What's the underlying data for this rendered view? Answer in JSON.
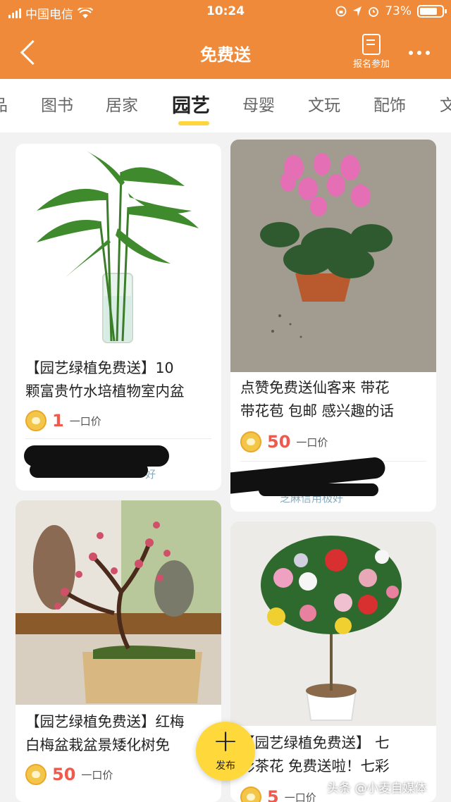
{
  "status_bar": {
    "carrier": "中国电信",
    "time": "10:24",
    "battery": "73%"
  },
  "nav": {
    "title": "免费送",
    "signup_label": "报名参加"
  },
  "tabs": [
    "品",
    "图书",
    "居家",
    "园艺",
    "母婴",
    "文玩",
    "配饰",
    "文"
  ],
  "active_tab": "园艺",
  "cards": [
    {
      "title_line1": "【园艺绿植免费送】10",
      "title_line2": "颗富贵竹水培植物室内盆",
      "price": "1",
      "price_label": "一口价",
      "user_text": "好"
    },
    {
      "title_line1": "点赞免费送仙客来 带花",
      "title_line2": "带花苞 包邮 感兴趣的话",
      "price": "50",
      "price_label": "一口价",
      "user_text": "芝麻信用极好"
    },
    {
      "title_line1": "【园艺绿植免费送】红梅",
      "title_line2": "白梅盆栽盆景矮化树免",
      "price": "50",
      "price_label": "一口价"
    },
    {
      "title_line1": "【园艺绿植免费送】 七",
      "title_line2": "彩茶花 免费送啦！七彩",
      "price": "5",
      "price_label": "一口价"
    }
  ],
  "fab_label": "发布",
  "watermark": "头条 @小麦自媒体",
  "colors": {
    "header": "#ee8a3a",
    "accent": "#ffd83c",
    "price": "#ee5b4e"
  }
}
